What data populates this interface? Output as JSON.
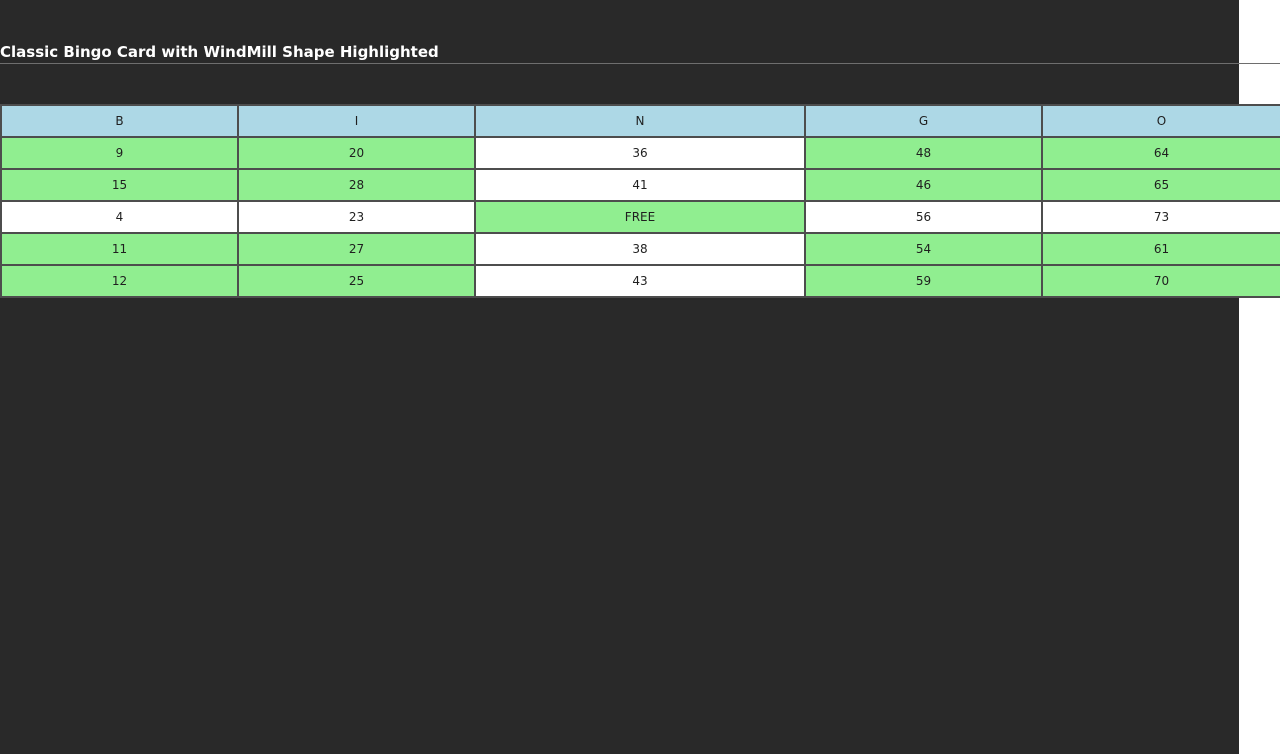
{
  "page": {
    "title": "Classic Bingo Card with WindMill Shape Highlighted"
  },
  "colors": {
    "background": "#292929",
    "header": "#add8e6",
    "highlight": "#90ee90",
    "cell": "#ffffff",
    "border": "#4d4d4d"
  },
  "card": {
    "headers": [
      "B",
      "I",
      "N",
      "G",
      "O"
    ],
    "rows": [
      [
        {
          "value": "9",
          "highlighted": true
        },
        {
          "value": "20",
          "highlighted": true
        },
        {
          "value": "36",
          "highlighted": false
        },
        {
          "value": "48",
          "highlighted": true
        },
        {
          "value": "64",
          "highlighted": true
        }
      ],
      [
        {
          "value": "15",
          "highlighted": true
        },
        {
          "value": "28",
          "highlighted": true
        },
        {
          "value": "41",
          "highlighted": false
        },
        {
          "value": "46",
          "highlighted": true
        },
        {
          "value": "65",
          "highlighted": true
        }
      ],
      [
        {
          "value": "4",
          "highlighted": false
        },
        {
          "value": "23",
          "highlighted": false
        },
        {
          "value": "FREE",
          "highlighted": true
        },
        {
          "value": "56",
          "highlighted": false
        },
        {
          "value": "73",
          "highlighted": false
        }
      ],
      [
        {
          "value": "11",
          "highlighted": true
        },
        {
          "value": "27",
          "highlighted": true
        },
        {
          "value": "38",
          "highlighted": false
        },
        {
          "value": "54",
          "highlighted": true
        },
        {
          "value": "61",
          "highlighted": true
        }
      ],
      [
        {
          "value": "12",
          "highlighted": true
        },
        {
          "value": "25",
          "highlighted": true
        },
        {
          "value": "43",
          "highlighted": false
        },
        {
          "value": "59",
          "highlighted": true
        },
        {
          "value": "70",
          "highlighted": true
        }
      ]
    ]
  }
}
